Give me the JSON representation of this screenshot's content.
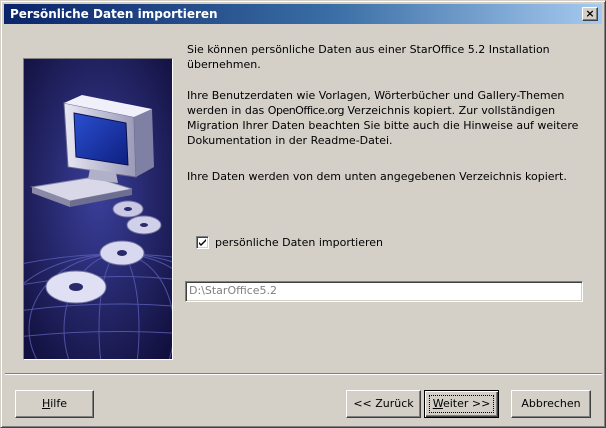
{
  "window": {
    "title": "Persönliche Daten importieren",
    "close_glyph": "×"
  },
  "body": {
    "paragraph1": "Sie können persönliche Daten aus einer StarOffice 5.2 Installation übernehmen.",
    "paragraph2_before": "Ihre Benutzerdaten wie Vorlagen, Wörterbücher und Gallery-Themen werden in das ",
    "paragraph2_brand": "OpenOffice.org",
    "paragraph2_after": " Verzeichnis kopiert. Zur vollständigen Migration Ihrer Daten beachten Sie bitte auch die Hinweise auf weitere Dokumentation in der Readme-Datei.",
    "paragraph3": "Ihre Daten werden von dem unten angegebenen Verzeichnis kopiert."
  },
  "import_checkbox": {
    "label": "persönliche Daten importieren",
    "checked": true
  },
  "path_field": {
    "value": "D:\\StarOffice5.2"
  },
  "buttons": {
    "help_first": "H",
    "help_rest": "ilfe",
    "back": "<< Zurück",
    "next_first": "W",
    "next_rest": "eiter >>",
    "cancel": "Abbrechen"
  },
  "icons": {
    "illustration": "computer-with-cds-illustration",
    "checkmark": "checkmark-icon"
  }
}
